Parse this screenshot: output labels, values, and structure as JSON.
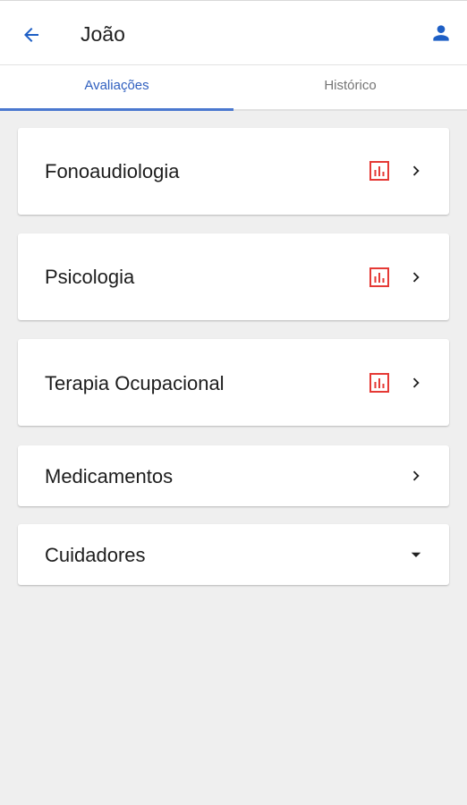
{
  "app_bar": {
    "title": "João",
    "back_icon": "arrow-back-icon",
    "user_icon": "person-icon",
    "accent_color": "#1e5fc5"
  },
  "tabs": [
    {
      "label": "Avaliações",
      "active": true
    },
    {
      "label": "Histórico",
      "active": false
    }
  ],
  "cards": [
    {
      "label": "Fonoaudiologia",
      "has_report": true,
      "trailing": "chevron-right-icon"
    },
    {
      "label": "Psicologia",
      "has_report": true,
      "trailing": "chevron-right-icon"
    },
    {
      "label": "Terapia Ocupacional",
      "has_report": true,
      "trailing": "chevron-right-icon"
    },
    {
      "label": "Medicamentos",
      "has_report": false,
      "trailing": "chevron-right-icon"
    },
    {
      "label": "Cuidadores",
      "has_report": false,
      "trailing": "caret-down-icon"
    }
  ],
  "colors": {
    "report_icon": "#e53935",
    "tab_active": "#2f5fbf",
    "tab_inactive": "#757575",
    "background": "#efefef"
  }
}
